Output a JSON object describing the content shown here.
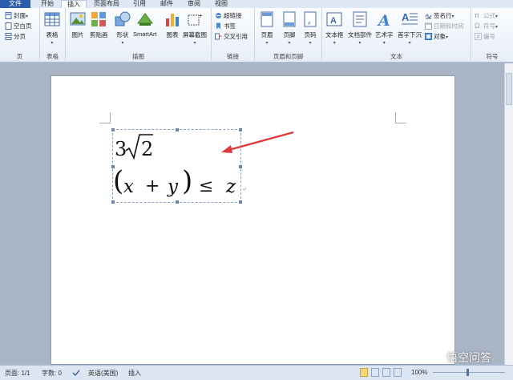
{
  "tabs": [
    {
      "label": "文件"
    },
    {
      "label": "开始"
    },
    {
      "label": "插入"
    },
    {
      "label": "页面布局"
    },
    {
      "label": "引用"
    },
    {
      "label": "邮件"
    },
    {
      "label": "审阅"
    },
    {
      "label": "视图"
    }
  ],
  "ribbon": {
    "pages": {
      "label": "页",
      "items": [
        "封面",
        "空白页",
        "分页"
      ]
    },
    "tables": {
      "label": "表格",
      "item": "表格"
    },
    "illustrations": {
      "label": "插图",
      "items": [
        "图片",
        "剪贴画",
        "形状",
        "SmartArt",
        "图表",
        "屏幕截图"
      ]
    },
    "links": {
      "label": "链接",
      "items": [
        "超链接",
        "书签",
        "交叉引用"
      ]
    },
    "header_footer": {
      "label": "页眉和页脚",
      "items": [
        "页眉",
        "页脚",
        "页码"
      ]
    },
    "text": {
      "label": "文本",
      "items": [
        "文本框",
        "文档部件",
        "艺术字",
        "首字下沉"
      ],
      "small": [
        "签名行",
        "日期和时间",
        "对象"
      ]
    },
    "symbols": {
      "label": "符号",
      "items": [
        "公式",
        "符号",
        "编号"
      ]
    }
  },
  "formula": {
    "line1_coef": "3",
    "line1_radicand": "2",
    "line2": {
      "open": "(",
      "x": "x",
      "plus": "+",
      "y": "y",
      "close": ")",
      "leq": "≤",
      "z": "z"
    },
    "paragraph_mark": "↵"
  },
  "status": {
    "page": "页面: 1/1",
    "words": "字数: 0",
    "language": "英语(美国)",
    "mode": "插入",
    "zoom": "100%"
  },
  "watermark": "悟空问答"
}
